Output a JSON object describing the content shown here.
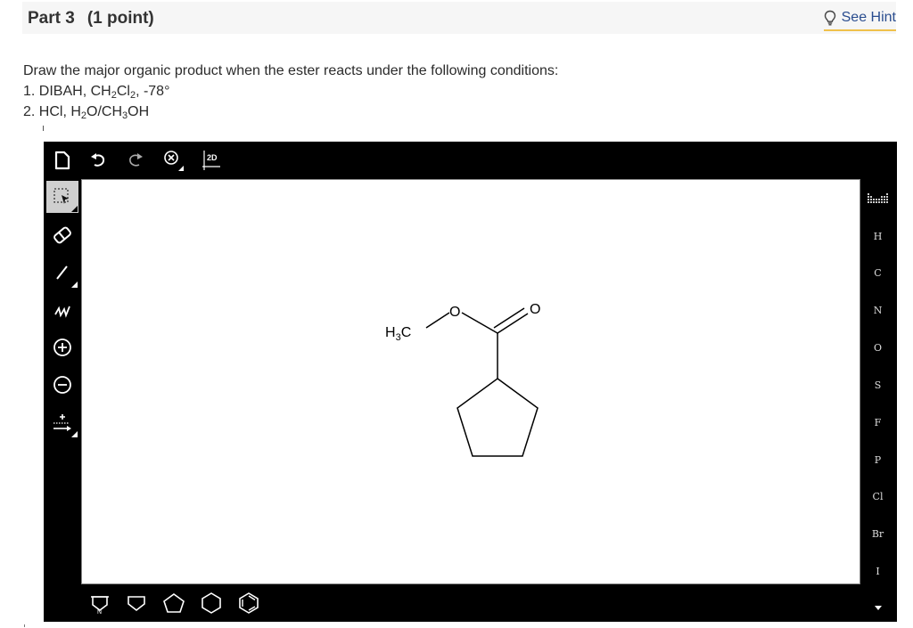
{
  "header": {
    "part": "Part 3",
    "points": "(1 point)",
    "hint_label": "See Hint"
  },
  "question": {
    "prompt": "Draw the major organic product when the ester reacts under the following conditions:",
    "step1": {
      "num": "1. ",
      "r1": "DIBAH, CH",
      "s1": "2",
      "r2": "Cl",
      "s2": "2",
      "r3": ", -78°"
    },
    "step2": {
      "num": "2. ",
      "r1": "HCl, H",
      "s1": "2",
      "r2": "O/CH",
      "s2": "3",
      "r3": "OH"
    }
  },
  "editor": {
    "top_toolbar": {
      "new_icon": "new-document-icon",
      "undo_icon": "undo-icon",
      "redo_icon": "redo-icon",
      "clear_icon": "clear-icon",
      "mode_label": "2D"
    },
    "left_tools": [
      "select-icon",
      "eraser-icon",
      "bond-icon",
      "chain-icon",
      "positive-charge-icon",
      "negative-charge-icon",
      "reaction-arrow-icon"
    ],
    "elements": [
      "H",
      "C",
      "N",
      "O",
      "S",
      "F",
      "P",
      "Cl",
      "Br",
      "I"
    ],
    "periodic_table_icon": "periodic-table-icon",
    "bottom_tools": [
      "ring-template-icon",
      "cyclopropane-icon",
      "cyclobutane-icon",
      "cyclopentane-icon",
      "cyclohexane-icon",
      "benzene-icon"
    ],
    "molecule": {
      "atoms": {
        "methyl_main": "H",
        "methyl_sub": "3",
        "methyl_tail": "C",
        "ester_oxygen": "O",
        "carbonyl_oxygen": "O"
      }
    }
  }
}
